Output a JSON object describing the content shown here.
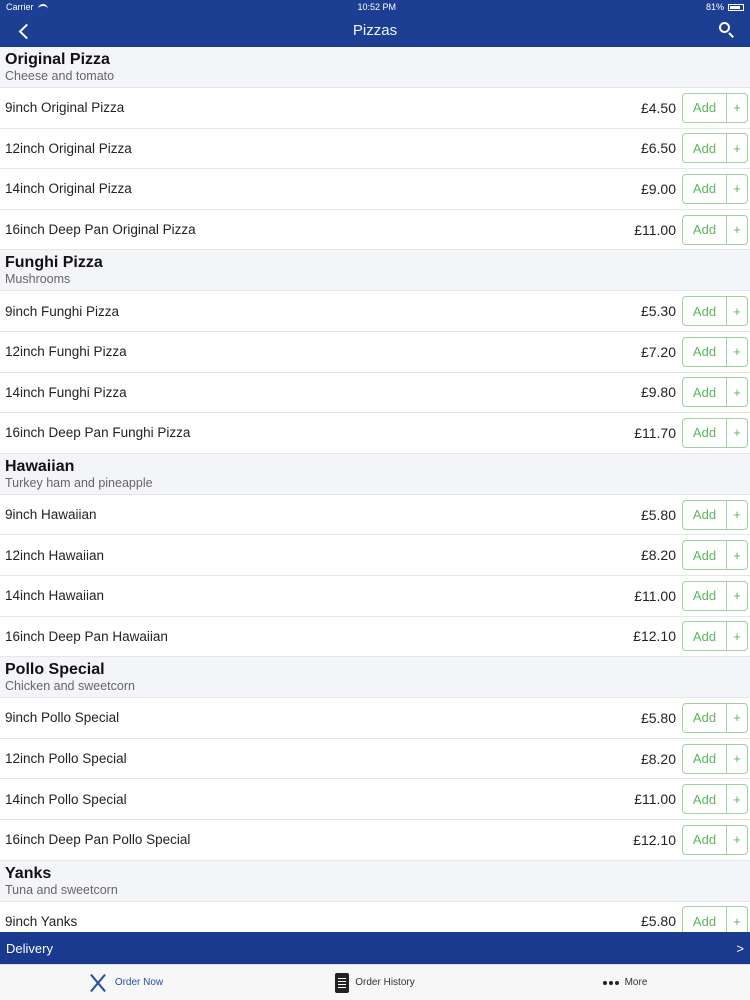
{
  "status": {
    "carrier": "Carrier",
    "time": "10:52 PM",
    "battery": "81%"
  },
  "nav": {
    "title": "Pizzas"
  },
  "add_label": "Add",
  "plus_label": "+",
  "sections": [
    {
      "title": "Original Pizza",
      "subtitle": "Cheese and tomato",
      "items": [
        {
          "name": "9inch Original Pizza",
          "price": "£4.50"
        },
        {
          "name": "12inch Original Pizza",
          "price": "£6.50"
        },
        {
          "name": "14inch Original Pizza",
          "price": "£9.00"
        },
        {
          "name": "16inch Deep Pan Original Pizza",
          "price": "£11.00"
        }
      ]
    },
    {
      "title": "Funghi Pizza",
      "subtitle": "Mushrooms",
      "items": [
        {
          "name": "9inch Funghi Pizza",
          "price": "£5.30"
        },
        {
          "name": "12inch Funghi Pizza",
          "price": "£7.20"
        },
        {
          "name": "14inch Funghi Pizza",
          "price": "£9.80"
        },
        {
          "name": "16inch Deep Pan Funghi Pizza",
          "price": "£11.70"
        }
      ]
    },
    {
      "title": "Hawaiian",
      "subtitle": "Turkey ham and pineapple",
      "items": [
        {
          "name": "9inch Hawaiian",
          "price": "£5.80"
        },
        {
          "name": "12inch Hawaiian",
          "price": "£8.20"
        },
        {
          "name": "14inch Hawaiian",
          "price": "£11.00"
        },
        {
          "name": "16inch Deep Pan Hawaiian",
          "price": "£12.10"
        }
      ]
    },
    {
      "title": "Pollo Special",
      "subtitle": "Chicken and sweetcorn",
      "items": [
        {
          "name": "9inch Pollo Special",
          "price": "£5.80"
        },
        {
          "name": "12inch Pollo Special",
          "price": "£8.20"
        },
        {
          "name": "14inch Pollo Special",
          "price": "£11.00"
        },
        {
          "name": "16inch Deep Pan Pollo Special",
          "price": "£12.10"
        }
      ]
    },
    {
      "title": "Yanks",
      "subtitle": "Tuna and sweetcorn",
      "items": [
        {
          "name": "9inch Yanks",
          "price": "£5.80"
        }
      ]
    }
  ],
  "delivery": {
    "label": "Delivery",
    "arrow": ">"
  },
  "tabs": [
    {
      "label": "Order Now",
      "icon": "fork-knife-icon"
    },
    {
      "label": "Order History",
      "icon": "clipboard-icon"
    },
    {
      "label": "More",
      "icon": "more-dots-icon"
    }
  ],
  "colors": {
    "nav": "#1c3f93",
    "add_green": "#5bb85b",
    "delivery": "#1a3a8f",
    "tab_active": "#2a4ea0"
  }
}
